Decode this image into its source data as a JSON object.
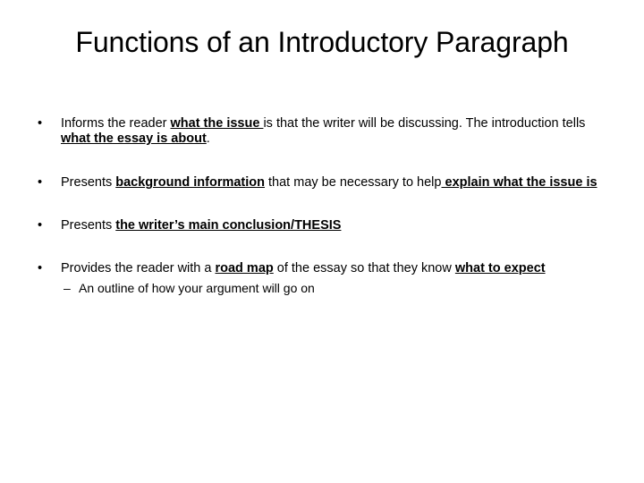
{
  "slide": {
    "background_color": "#ffffff",
    "text_color": "#000000",
    "title": "Functions of an Introductory Paragraph",
    "bullet_marker": "•",
    "sub_bullet_marker": "–",
    "bullets": [
      {
        "id": "bullet-informs-reader",
        "runs": [
          {
            "text": "Informs the reader ",
            "emphasis": false
          },
          {
            "text": "what the issue ",
            "emphasis": true
          },
          {
            "text": "is that the writer will be discussing. The introduction tells ",
            "emphasis": false
          },
          {
            "text": "what the essay is about",
            "emphasis": true
          },
          {
            "text": ".",
            "emphasis": false
          }
        ],
        "plain": "Informs the reader what the issue is that the writer will be discussing. The introduction tells what the essay is about."
      },
      {
        "id": "bullet-background-information",
        "runs": [
          {
            "text": "Presents ",
            "emphasis": false
          },
          {
            "text": "background information",
            "emphasis": true
          },
          {
            "text": " that may be necessary to help",
            "emphasis": false
          },
          {
            "text": " explain what the issue is",
            "emphasis": true
          }
        ],
        "plain": "Presents background information that may be necessary to help explain what the issue is"
      },
      {
        "id": "bullet-thesis",
        "runs": [
          {
            "text": "Presents ",
            "emphasis": false
          },
          {
            "text": "the writer’s main conclusion/THESIS",
            "emphasis": true
          }
        ],
        "plain": "Presents the writer’s main conclusion/THESIS"
      },
      {
        "id": "bullet-road-map",
        "runs": [
          {
            "text": "Provides the reader with a ",
            "emphasis": false
          },
          {
            "text": "road map",
            "emphasis": true
          },
          {
            "text": " of the essay so that they know ",
            "emphasis": false
          },
          {
            "text": "what to expect",
            "emphasis": true
          }
        ],
        "plain": "Provides the reader with a road map of the essay so that they know what to expect",
        "sub_bullets": [
          {
            "id": "sub-bullet-outline",
            "text": "An outline of how your argument will go on"
          }
        ]
      }
    ]
  }
}
